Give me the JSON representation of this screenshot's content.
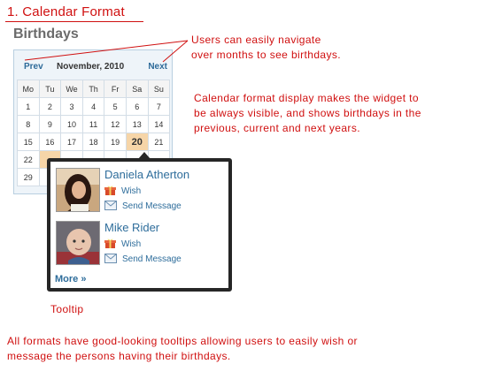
{
  "heading": "1. Calendar Format",
  "widget": {
    "title": "Birthdays",
    "calendar": {
      "prev_label": "Prev",
      "month_label": "November, 2010",
      "next_label": "Next",
      "weekdays": [
        "Mo",
        "Tu",
        "We",
        "Th",
        "Fr",
        "Sa",
        "Su"
      ],
      "weeks": [
        [
          "1",
          "2",
          "3",
          "4",
          "5",
          "6",
          "7"
        ],
        [
          "8",
          "9",
          "10",
          "11",
          "12",
          "13",
          "14"
        ],
        [
          "15",
          "16",
          "17",
          "18",
          "19",
          "20",
          "21"
        ],
        [
          "22",
          "",
          "",
          "",
          "",
          "",
          ""
        ],
        [
          "29",
          "",
          "",
          "",
          "",
          "",
          ""
        ]
      ],
      "today": "20"
    }
  },
  "tooltip": {
    "people": [
      {
        "name": "Daniela Atherton",
        "wish_label": "Wish",
        "message_label": "Send Message"
      },
      {
        "name": "Mike Rider",
        "wish_label": "Wish",
        "message_label": "Send Message"
      }
    ],
    "more_label": "More »"
  },
  "annotations": {
    "navigation": [
      "Users can easily navigate",
      "over months to see birthdays."
    ],
    "display": [
      "Calendar format display makes the widget to",
      "be always visible, and shows birthdays in the",
      "previous, current and next years."
    ],
    "tooltip_label": "Tooltip",
    "formats": [
      "All formats have good-looking tooltips allowing users to easily wish or",
      "message the persons having their birthdays."
    ]
  },
  "colors": {
    "annotation_red": "#d01010",
    "link_blue": "#2e6d9b",
    "highlight": "#f6d5a8",
    "tooltip_border": "#262626"
  },
  "icons": {
    "wish": "gift-icon",
    "message": "envelope-icon"
  }
}
